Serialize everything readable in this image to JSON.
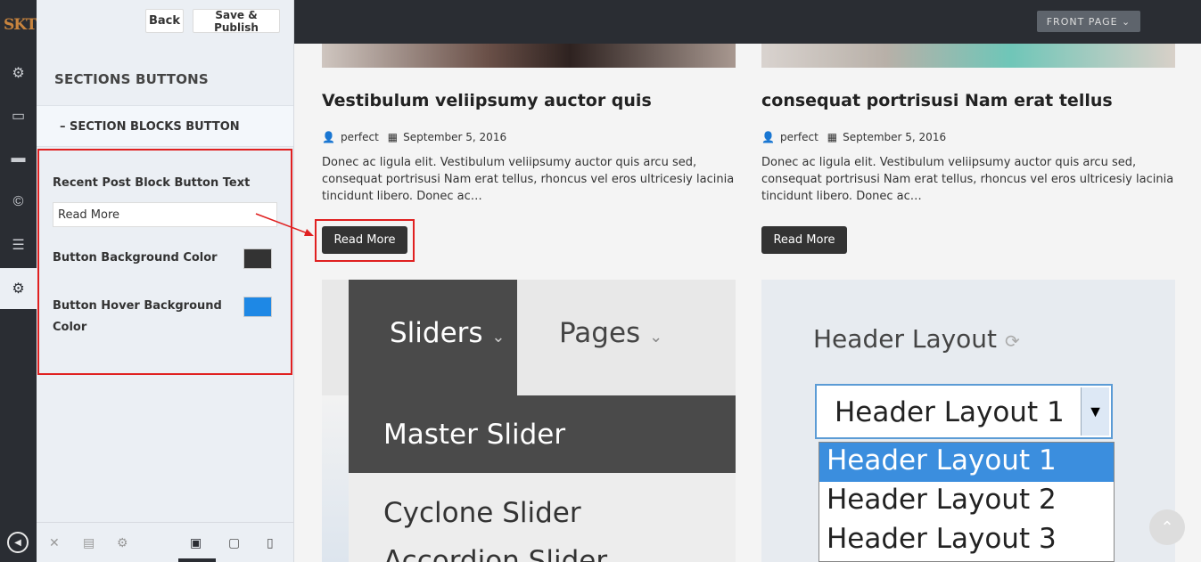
{
  "app": {
    "logo": "SKT"
  },
  "panel": {
    "back_label": "Back",
    "publish_label": "Save & Publish",
    "section_title": "SECTIONS BUTTONS",
    "subsection": "–  SECTION BLOCKS BUTTON",
    "field1_label": "Recent Post Block Button Text",
    "field1_value": "Read More",
    "field2_label": "Button Background Color",
    "field2_color": "#333333",
    "field3_label": "Button Hover Background Color",
    "field3_color": "#1e88e5"
  },
  "preview": {
    "front_page": "FRONT PAGE",
    "posts": [
      {
        "title": "Vestibulum veliipsumy auctor quis",
        "author": "perfect",
        "date": "September 5, 2016",
        "excerpt": "Donec ac ligula elit. Vestibulum veliipsumy auctor quis arcu sed, consequat portrisusi Nam erat tellus, rhoncus vel eros ultricesiy lacinia tincidunt libero. Donec ac…",
        "button": "Read More"
      },
      {
        "title": "consequat portrisusi Nam erat tellus",
        "author": "perfect",
        "date": "September 5, 2016",
        "excerpt": "Donec ac ligula elit. Vestibulum veliipsumy auctor quis arcu sed, consequat portrisusi Nam erat tellus, rhoncus vel eros ultricesiy lacinia tincidunt libero. Donec ac…",
        "button": "Read More"
      }
    ],
    "shot1": {
      "menu1": "Sliders",
      "menu2": "Pages",
      "item1": "Master Slider",
      "item2": "Cyclone Slider",
      "item3": "Accordion Slider"
    },
    "shot2": {
      "heading": "Header Layout",
      "selected": "Header Layout 1",
      "options": [
        "Header Layout 1",
        "Header Layout 2",
        "Header Layout 3"
      ]
    }
  },
  "colors": {
    "accent": "#e02020",
    "dark": "#2a2d33"
  }
}
